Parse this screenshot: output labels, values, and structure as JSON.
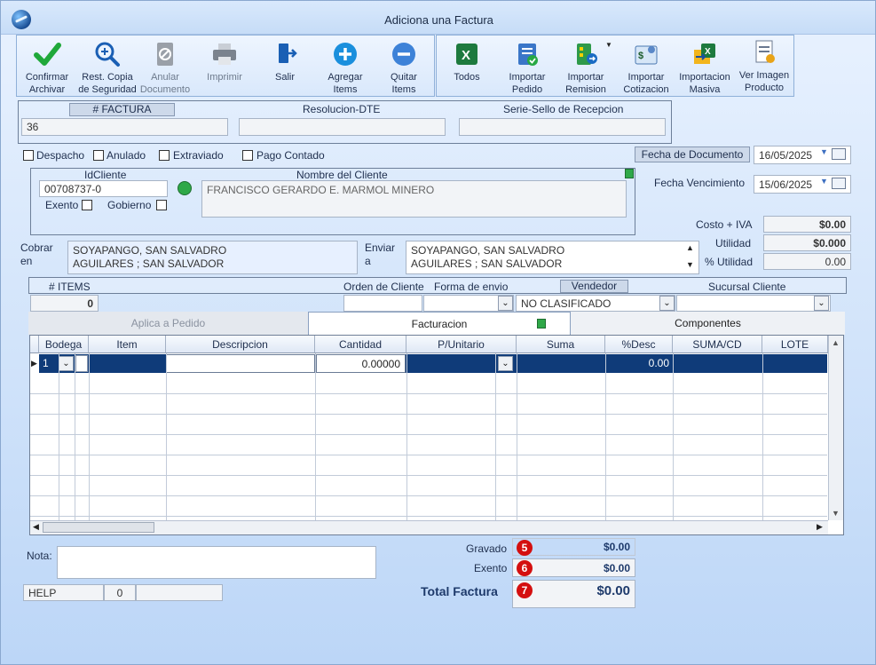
{
  "window": {
    "title": "Adiciona una Factura"
  },
  "toolbar": {
    "confirm": "Confirmar\nArchivar",
    "restore": "Rest. Copia\nde Seguridad",
    "void": "Anular\nDocumento",
    "print": "Imprimir",
    "exit": "Salir",
    "add_items": "Agregar\nItems",
    "remove_items": "Quitar\nItems",
    "all": "Todos",
    "import_order": "Importar\nPedido",
    "import_remission": "Importar\nRemision",
    "import_quote": "Importar\nCotizacion",
    "bulk_import": "Importacion\nMasiva",
    "view_image": "Ver Imagen\nProducto"
  },
  "header": {
    "invoice_label": "# FACTURA",
    "invoice_value": "36",
    "resolution_label": "Resolucion-DTE",
    "resolution_value": "",
    "seal_label": "Serie-Sello de Recepcion",
    "seal_value": ""
  },
  "flags": {
    "despacho": "Despacho",
    "anulado": "Anulado",
    "extraviado": "Extraviado",
    "pago_contado": "Pago Contado"
  },
  "dates": {
    "doc_date_label": "Fecha de  Documento",
    "doc_date": "16/05/2025",
    "due_date_label": "Fecha Vencimiento",
    "due_date": "15/06/2025"
  },
  "client": {
    "id_label": "IdCliente",
    "id_value": "00708737-0",
    "name_label": "Nombre del Cliente",
    "name_value": "FRANCISCO GERARDO E. MARMOL MINERO",
    "exento_label": "Exento",
    "gobierno_label": "Gobierno"
  },
  "costs": {
    "cost_iva_label": "Costo + IVA",
    "cost_iva": "$0.00",
    "utilidad_label": "Utilidad",
    "utilidad": "$0.000",
    "pct_utilidad_label": "% Utilidad",
    "pct_utilidad": "0.00"
  },
  "addresses": {
    "cobrar_label": "Cobrar\nen",
    "cobrar_line1": "SOYAPANGO, SAN SALVADRO",
    "cobrar_line2": "AGUILARES ; SAN SALVADOR",
    "enviar_label": "Enviar\na",
    "enviar_line1": "SOYAPANGO, SAN SALVADRO",
    "enviar_line2": "AGUILARES ; SAN SALVADOR"
  },
  "order": {
    "items_label": "# ITEMS",
    "items_value": "0",
    "client_order_label": "Orden de Cliente",
    "ship_method_label": "Forma de envio",
    "seller_label": "Vendedor",
    "seller_value": "NO CLASIFICADO",
    "branch_label": "Sucursal Cliente"
  },
  "tabs": [
    {
      "label": "Aplica a Pedido"
    },
    {
      "label": "Facturacion"
    },
    {
      "label": "Componentes"
    }
  ],
  "grid": {
    "columns": [
      "Bodega",
      "Item",
      "Descripcion",
      "Cantidad",
      "P/Unitario",
      "Suma",
      "%Desc",
      "SUMA/CD",
      "LOTE"
    ],
    "row": {
      "bodega": "1",
      "cantidad": "0.00000",
      "desc": "0.00"
    }
  },
  "footer": {
    "nota_label": "Nota:",
    "help_label": "HELP",
    "help_count": "0",
    "gravado_label": "Gravado",
    "gravado_value": "$0.00",
    "gravado_badge": "5",
    "exento_label": "Exento",
    "exento_value": "$0.00",
    "exento_badge": "6",
    "total_label": "Total Factura",
    "total_value": "$0.00",
    "total_badge": "7"
  },
  "colors": {
    "accent": "#0b3b78",
    "selected_row": "#0f3b79",
    "badge": "#d40f0f"
  }
}
